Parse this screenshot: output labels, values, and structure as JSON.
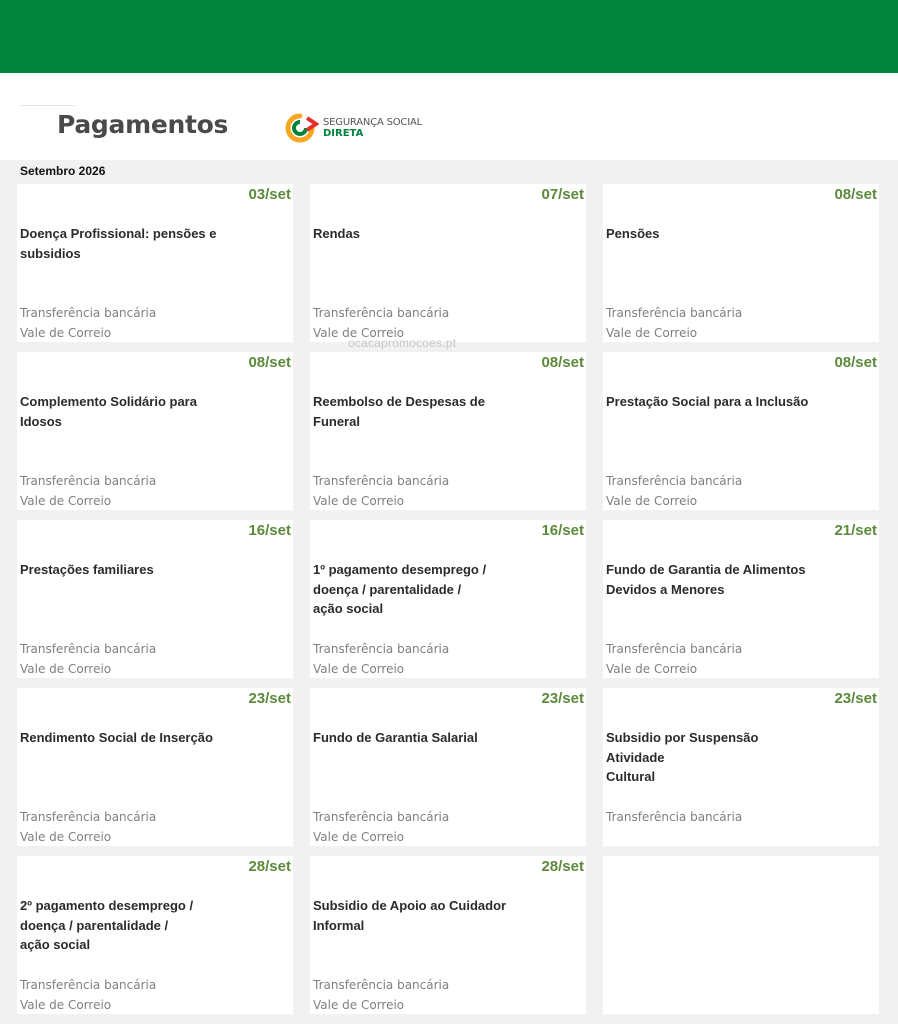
{
  "header": {
    "title": "Pagamentos",
    "logo_line1": "SEGURANÇA SOCIAL",
    "logo_line2": "DIRETA",
    "brand_color": "#00843d"
  },
  "calendar": {
    "month": "Setembro 2026",
    "cards": [
      {
        "date": "03/set",
        "title": "Doença Profissional: pensões e subsidios",
        "methods": [
          "Transferência bancária",
          "Vale de Correio"
        ]
      },
      {
        "date": "07/set",
        "title": "Rendas",
        "methods": [
          "Transferência bancária",
          "Vale de Correio"
        ]
      },
      {
        "date": "08/set",
        "title": "Pensões",
        "methods": [
          "Transferência bancária",
          "Vale de Correio"
        ]
      },
      {
        "date": "08/set",
        "title": "Complemento Solidário para\nIdosos",
        "methods": [
          "Transferência bancária",
          "Vale de Correio"
        ]
      },
      {
        "date": "08/set",
        "title": "Reembolso de Despesas de\nFuneral",
        "methods": [
          "Transferência bancária",
          "Vale de Correio"
        ]
      },
      {
        "date": "08/set",
        "title": "Prestação Social para a Inclusão",
        "methods": [
          "Transferência bancária",
          "Vale de Correio"
        ]
      },
      {
        "date": "16/set",
        "title": "Prestações familiares",
        "methods": [
          "Transferência bancária",
          "Vale de Correio"
        ]
      },
      {
        "date": "16/set",
        "title": "1º pagamento desemprego /\ndoença / parentalidade /\nação social",
        "methods": [
          "Transferência bancária",
          "Vale de Correio"
        ]
      },
      {
        "date": "21/set",
        "title": "Fundo de Garantia de Alimentos\n Devidos a Menores",
        "methods": [
          "Transferência bancária",
          "Vale de Correio"
        ]
      },
      {
        "date": "23/set",
        "title": "Rendimento Social de Inserção",
        "methods": [
          "Transferência bancária",
          "Vale de Correio"
        ]
      },
      {
        "date": "23/set",
        "title": "Fundo de Garantia Salarial",
        "methods": [
          "Transferência bancária",
          "Vale de Correio"
        ]
      },
      {
        "date": "23/set",
        "title": "Subsidio por Suspensão Atividade\nCultural",
        "methods": [
          "Transferência bancária"
        ]
      },
      {
        "date": "28/set",
        "title": "2º pagamento desemprego /\ndoença / parentalidade /\nação social",
        "methods": [
          "Transferência bancária",
          "Vale de Correio"
        ]
      },
      {
        "date": "28/set",
        "title": "Subsidio de Apoio ao Cuidador\n Informal",
        "methods": [
          "Transferência bancária",
          "Vale de Correio"
        ]
      },
      {
        "date": "",
        "title": "",
        "methods": []
      }
    ]
  },
  "watermark": "ocacapromocoes.pt"
}
